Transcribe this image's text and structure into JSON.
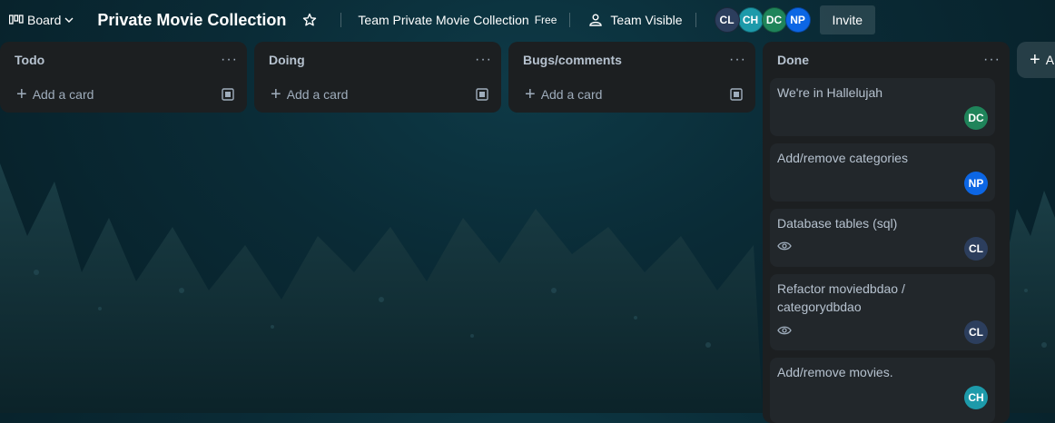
{
  "header": {
    "board_switch_label": "Board",
    "board_title": "Private Movie Collection",
    "team_name": "Team Private Movie Collection",
    "plan": "Free",
    "visibility": "Team Visible",
    "members": [
      "CL",
      "CH",
      "DC",
      "NP"
    ],
    "invite_label": "Invite"
  },
  "lists": [
    {
      "title": "Todo",
      "add_card": "Add a card"
    },
    {
      "title": "Doing",
      "add_card": "Add a card"
    },
    {
      "title": "Bugs/comments",
      "add_card": "Add a card"
    },
    {
      "title": "Done",
      "cards": [
        {
          "title": "We're in Hallelujah",
          "member": "DC"
        },
        {
          "title": "Add/remove categories",
          "member": "NP"
        },
        {
          "title": "Database tables (sql)",
          "member": "CL",
          "watching": true
        },
        {
          "title": "Refactor moviedbdao / categorydbdao",
          "member": "CL",
          "watching": true
        },
        {
          "title": "Add/remove movies.",
          "member": "CH"
        }
      ]
    }
  ],
  "add_list_label": "A",
  "colors": {
    "cl": "#2c3e5d",
    "ch": "#1d9aaa",
    "dc": "#1f845a",
    "np": "#0c66e4",
    "list_bg": "#1c1f21",
    "card_bg": "#22272b"
  }
}
